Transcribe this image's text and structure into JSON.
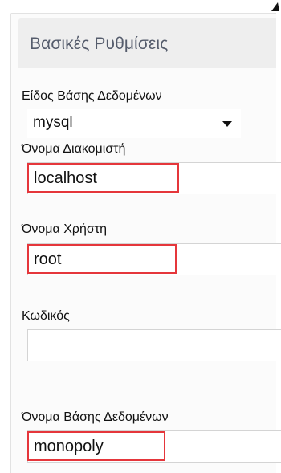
{
  "panel": {
    "title": "Βασικές Ρυθμίσεις"
  },
  "fields": {
    "db_type": {
      "label": "Είδος Βάσης Δεδομένων",
      "value": "mysql"
    },
    "server_name": {
      "label": "Όνομα Διακομιστή",
      "value": "localhost"
    },
    "username": {
      "label": "Όνομα Χρήστη",
      "value": "root"
    },
    "password": {
      "label": "Κωδικός",
      "value": ""
    },
    "db_name": {
      "label": "Όνομα Βάσης Δεδομένων",
      "value": "monopoly"
    }
  },
  "colors": {
    "highlight": "#e5363b",
    "title": "#555c6c",
    "header_bg": "#eeeeee"
  }
}
